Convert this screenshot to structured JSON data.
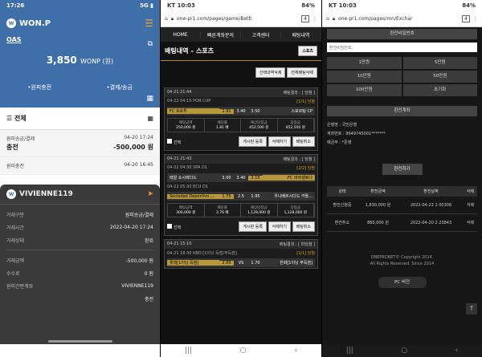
{
  "p1": {
    "time": "17:26",
    "signal": "5G",
    "brand": "WON.P",
    "oas": "OAS",
    "balance": "3,850",
    "unit": "WONP (원)",
    "link1": "•원피충전",
    "link2": "•결제/송금",
    "all": "전체",
    "tx": [
      {
        "type": "원피송금/결제",
        "date": "04-20 17:24",
        "name": "충전",
        "amount": "-500,000 원"
      },
      {
        "type": "원피충전",
        "date": "04-20 16:45",
        "name": "",
        "amount": ""
      }
    ],
    "modal": {
      "title": "VIVIENNE119",
      "rows": [
        [
          "거래구분",
          "원피송금/결제"
        ],
        [
          "거래시간",
          "2022-04-20 17:24"
        ],
        [
          "거래상태",
          "완료"
        ]
      ],
      "rows2": [
        [
          "거래금액",
          "-500,000 원"
        ],
        [
          "수수료",
          "0 원"
        ],
        [
          "원피간편계좌",
          "VIVIENNE119"
        ],
        [
          "",
          "충전"
        ]
      ]
    }
  },
  "p2": {
    "time": "KT 10:03",
    "battery": "84%",
    "url": "one-pr1.com/pages/game/Betti",
    "tabs": "4",
    "nav": [
      "HOME",
      "빠른계좌문의",
      "고객센터",
      "배팅내역"
    ],
    "title": "배팅내역 – 스포츠",
    "sport": "스포츠",
    "btn1": "선택내역삭제",
    "btn2": "전체배팅삭제",
    "bets": [
      {
        "time": "04-21 21:44",
        "status": "배팅결과 : [ 당첨 ]",
        "result": "[1/1] 당첨",
        "match": "04-22 04:15  POR CUP",
        "picks": [
          [
            "FC 포르투",
            "1.91",
            "3.40",
            "3.50",
            "스포르팅 CP"
          ]
        ],
        "amt": "250,000 원",
        "odds": "1.81 배",
        "exp": "452,500 원",
        "win": "452,500 원"
      },
      {
        "time": "04-21 21:43",
        "status": "배팅결과 : [ 당첨 ]",
        "result": "[2/2] 당첨",
        "match": "04-22 04:30  SPA D1",
        "match2": "04-22 05:30  ECU D1",
        "picks": [
          [
            "레알 소시에다드",
            "3.00",
            "3.40",
            "2.15",
            "FC 바르셀로나"
          ],
          [
            "Sociedad Deportivo ...",
            "1.75",
            "2.5",
            "1.95",
            "우니베르시다드 카톨..."
          ]
        ],
        "amt": "300,000 원",
        "odds": "3.76 배",
        "exp": "1,128,000 원",
        "win": "1,128,000 원"
      },
      {
        "time": "04-21 15:10",
        "status": "배팅결과 : [ 미당첨 ]",
        "result": "[1/1] 당첨",
        "match": "04-21 18:30  KBO [1이닝 득점/무득점]",
        "picks": [
          [
            "롯데[1이닝 득점]",
            "2.00",
            "VS",
            "1.70",
            "한화[1이닝 무득점]"
          ]
        ]
      }
    ],
    "lbl": {
      "amt": "배팅금액",
      "odds": "배당률",
      "exp": "예상당첨금",
      "win": "당첨금",
      "sel": "선택",
      "g": "게시판 등록",
      "d": "삭제하기",
      "x": "배팅취소"
    }
  },
  "p3": {
    "time": "KT 10:03",
    "battery": "84%",
    "url": "one-pr1.com/pages/mn/Exchar",
    "tabs": "4",
    "acct_label": "환전비밀번호",
    "pw_ph": "환전비밀번호.",
    "amts": [
      "1만원",
      "5만원",
      "10만원",
      "50만원",
      "100만원",
      "초기화"
    ],
    "acct": "환전계좌",
    "bank": "은행명 : 국민은행",
    "accno": "계좌번호 : 9649745001*******",
    "holder": "예금주 : *준영",
    "cbtn": "환전하기",
    "cols": [
      "상태",
      "환전금액",
      "환전날짜",
      "삭제"
    ],
    "rows": [
      [
        "환전신청중",
        "1,830,000 원",
        "2022-04-22 1 00306",
        "삭제"
      ],
      [
        "환전취소",
        "860,000 원",
        "2022-04-20 2 23843",
        "삭제"
      ]
    ],
    "copy": "ONEPROBET© Copyright 2014.",
    "since": "All Rights Reserved. Since 2014",
    "pc": "PC 버전"
  }
}
